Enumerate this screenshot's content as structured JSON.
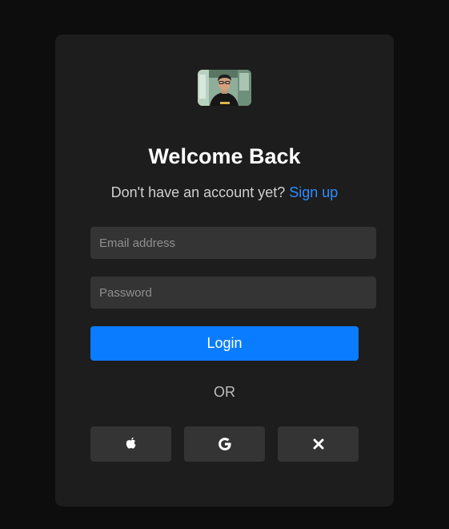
{
  "login": {
    "title": "Welcome Back",
    "signup_prompt": "Don't have an account yet?",
    "signup_link": "Sign up",
    "email_placeholder": "Email address",
    "password_placeholder": "Password",
    "login_label": "Login",
    "divider": "OR"
  },
  "social": [
    {
      "icon": "apple-icon"
    },
    {
      "icon": "google-icon"
    },
    {
      "icon": "x-icon"
    }
  ],
  "colors": {
    "background": "#0d0d0d",
    "card": "#1d1d1d",
    "input": "#343434",
    "accent": "#0a7cff",
    "link": "#2e8bff"
  }
}
